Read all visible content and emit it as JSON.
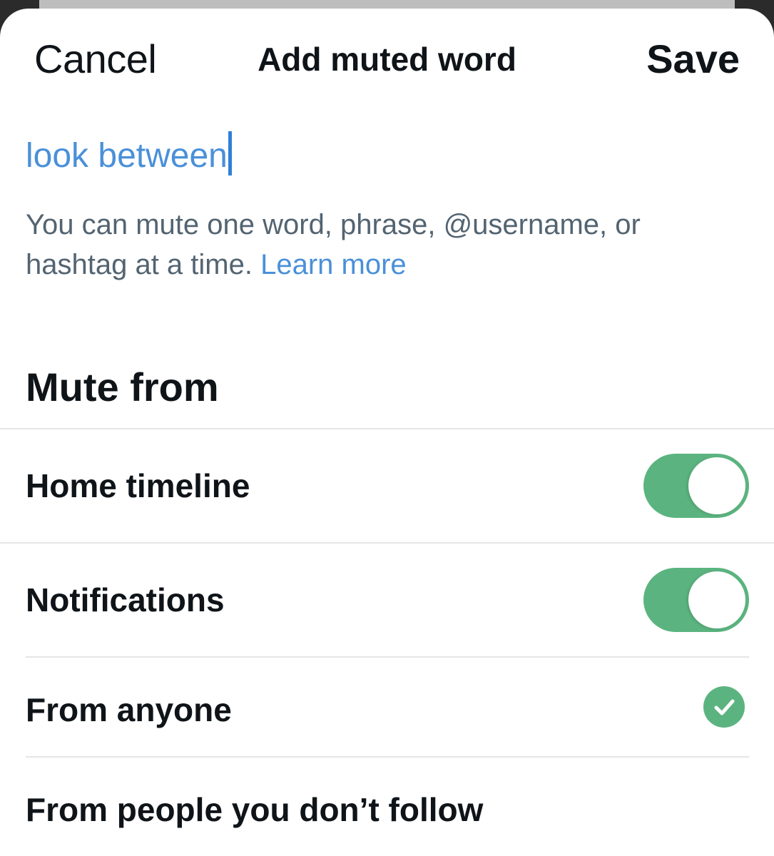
{
  "header": {
    "cancel_label": "Cancel",
    "title": "Add muted word",
    "save_label": "Save"
  },
  "input": {
    "value": "look between",
    "placeholder": ""
  },
  "helper": {
    "text": "You can mute one word, phrase, @username, or hashtag at a time.",
    "link_label": "Learn more"
  },
  "mute_from": {
    "heading": "Mute from",
    "options": [
      {
        "label": "Home timeline",
        "enabled": true,
        "control": "toggle"
      },
      {
        "label": "Notifications",
        "enabled": true,
        "control": "toggle"
      }
    ]
  },
  "audience": {
    "options": [
      {
        "label": "From anyone",
        "selected": true,
        "icon": "checkmark-circle-icon"
      },
      {
        "label": "From people you don’t follow",
        "selected": false
      }
    ]
  },
  "colors": {
    "accent": "#4a90d9",
    "toggle_on": "#5bb47f",
    "text_primary": "#0f1419",
    "text_secondary": "#536471"
  }
}
